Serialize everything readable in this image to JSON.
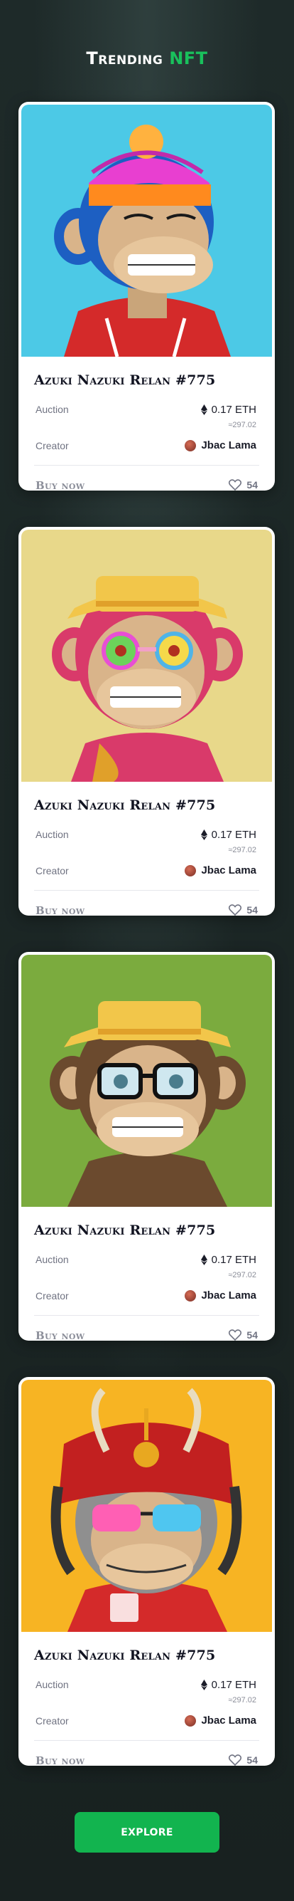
{
  "page": {
    "title_main": "Trending ",
    "title_accent": "NFT"
  },
  "cards": [
    {
      "title": "Azuki Nazuki Relan #775",
      "auction_label": "Auction",
      "price": "0.17 ETH",
      "usd": "≈297.02",
      "creator_label": "Creator",
      "creator_name": "Jbac Lama",
      "buy_label": "Buy now",
      "likes": "54",
      "art": "blue-ape-pink-beanie"
    },
    {
      "title": "Azuki Nazuki Relan #775",
      "auction_label": "Auction",
      "price": "0.17 ETH",
      "usd": "≈297.02",
      "creator_label": "Creator",
      "creator_name": "Jbac Lama",
      "buy_label": "Buy now",
      "likes": "54",
      "art": "pink-ape-sailor-hat"
    },
    {
      "title": "Azuki Nazuki Relan #775",
      "auction_label": "Auction",
      "price": "0.17 ETH",
      "usd": "≈297.02",
      "creator_label": "Creator",
      "creator_name": "Jbac Lama",
      "buy_label": "Buy now",
      "likes": "54",
      "art": "brown-ape-glasses"
    },
    {
      "title": "Azuki Nazuki Relan #775",
      "auction_label": "Auction",
      "price": "0.17 ETH",
      "usd": "≈297.02",
      "creator_label": "Creator",
      "creator_name": "Jbac Lama",
      "buy_label": "Buy now",
      "likes": "54",
      "art": "grey-ape-samurai-helmet"
    }
  ],
  "explore_label": "EXPLORE",
  "colors": {
    "accent": "#19c15c",
    "background": "#1b2423",
    "art_backgrounds": [
      "#4cc9e6",
      "#e8d88a",
      "#7bab3e",
      "#f7b423"
    ]
  },
  "icons": [
    "ethereum-icon",
    "heart-icon",
    "creator-avatar"
  ]
}
